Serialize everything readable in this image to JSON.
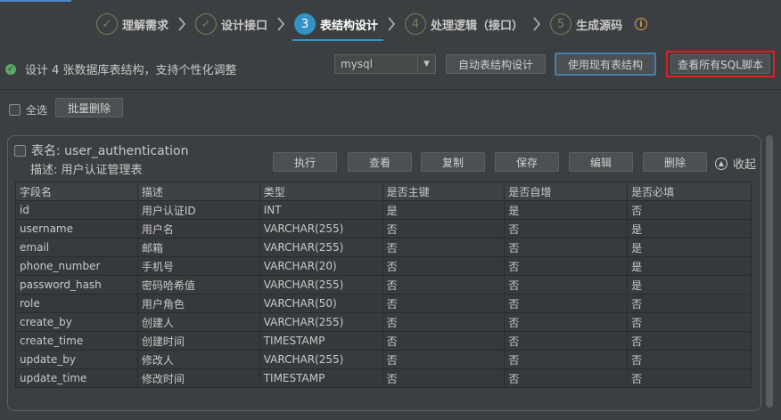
{
  "steps": [
    {
      "number": "✓",
      "label": "理解需求",
      "state": "done"
    },
    {
      "number": "✓",
      "label": "设计接口",
      "state": "done"
    },
    {
      "number": "3",
      "label": "表结构设计",
      "state": "active"
    },
    {
      "number": "4",
      "label": "处理逻辑（接口）",
      "state": "todo"
    },
    {
      "number": "5",
      "label": "生成源码",
      "state": "todo"
    }
  ],
  "status": {
    "text": "设计 4 张数据库表结构，支持个性化调整"
  },
  "db_select": {
    "value": "mysql"
  },
  "actions": {
    "auto_design": "自动表结构设计",
    "use_existing": "使用现有表结构",
    "view_sql": "查看所有SQL脚本"
  },
  "selection": {
    "select_all": "全选",
    "batch_delete": "批量删除"
  },
  "table": {
    "name_label": "表名: user_authentication",
    "desc_label": "描述: 用户认证管理表",
    "buttons": {
      "execute": "执行",
      "view": "查看",
      "copy": "复制",
      "save": "保存",
      "edit": "编辑",
      "delete": "删除",
      "collapse": "收起"
    },
    "columns": [
      "字段名",
      "描述",
      "类型",
      "是否主键",
      "是否自增",
      "是否必填"
    ],
    "rows": [
      [
        "id",
        "用户认证ID",
        "INT",
        "是",
        "是",
        "否"
      ],
      [
        "username",
        "用户名",
        "VARCHAR(255)",
        "否",
        "否",
        "是"
      ],
      [
        "email",
        "邮箱",
        "VARCHAR(255)",
        "否",
        "否",
        "是"
      ],
      [
        "phone_number",
        "手机号",
        "VARCHAR(20)",
        "否",
        "否",
        "是"
      ],
      [
        "password_hash",
        "密码哈希值",
        "VARCHAR(255)",
        "否",
        "否",
        "是"
      ],
      [
        "role",
        "用户角色",
        "VARCHAR(50)",
        "否",
        "否",
        "否"
      ],
      [
        "create_by",
        "创建人",
        "VARCHAR(255)",
        "否",
        "否",
        "否"
      ],
      [
        "create_time",
        "创建时间",
        "TIMESTAMP",
        "否",
        "否",
        "否"
      ],
      [
        "update_by",
        "修改人",
        "VARCHAR(255)",
        "否",
        "否",
        "否"
      ],
      [
        "update_time",
        "修改时间",
        "TIMESTAMP",
        "否",
        "否",
        "否"
      ]
    ]
  },
  "colors": {
    "accent": "#3592c4",
    "done": "#6a8759",
    "highlight": "#e02020"
  }
}
